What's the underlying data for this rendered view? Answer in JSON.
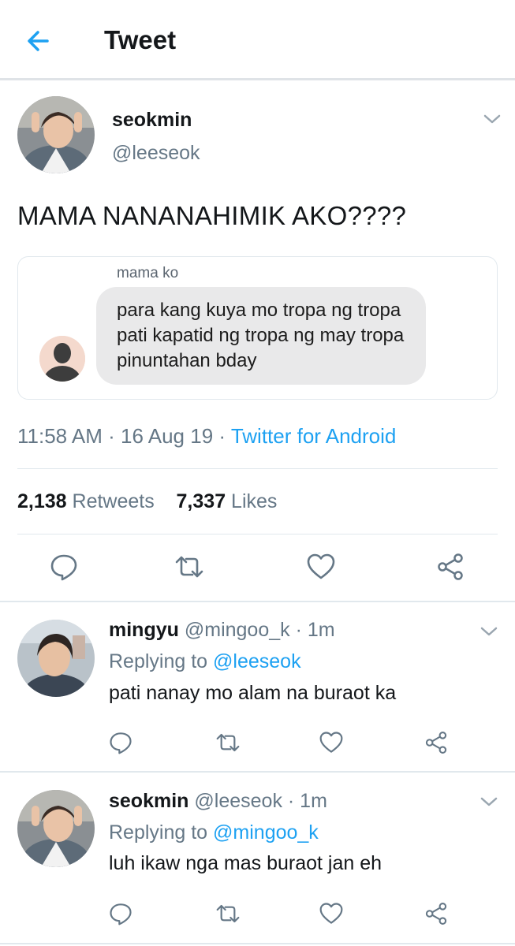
{
  "header": {
    "title": "Tweet"
  },
  "tweet": {
    "author_name": "seokmin",
    "author_handle": "@leeseok",
    "text": "MAMA NANANAHIMIK AKO????",
    "embed": {
      "sender": "mama ko",
      "message": "para kang kuya mo tropa ng tropa pati kapatid ng tropa ng may tropa pinuntahan bday"
    },
    "time": "11:58 AM",
    "date": "16 Aug 19",
    "source": "Twitter for Android",
    "separator": " · ",
    "retweets_count": "2,138",
    "retweets_label": "Retweets",
    "likes_count": "7,337",
    "likes_label": "Likes"
  },
  "replies": [
    {
      "name": "mingyu",
      "handle": "@mingoo_k",
      "time": "1m",
      "replying_label": "Replying to",
      "replying_to": "@leeseok",
      "text": "pati nanay mo alam na buraot ka"
    },
    {
      "name": "seokmin",
      "handle": "@leeseok",
      "time": "1m",
      "replying_label": "Replying to",
      "replying_to": "@mingoo_k",
      "text": "luh ikaw nga mas buraot jan eh"
    }
  ],
  "icons": {
    "back": "arrow-left-icon",
    "caret": "chevron-down-icon",
    "reply": "speech-bubble-icon",
    "retweet": "retweet-icon",
    "like": "heart-icon",
    "share": "share-icon"
  },
  "colors": {
    "accent": "#1da1f2",
    "text": "#14171a",
    "secondary": "#657786",
    "divider": "#e1e8ed",
    "bubble": "#e9e9ea"
  }
}
